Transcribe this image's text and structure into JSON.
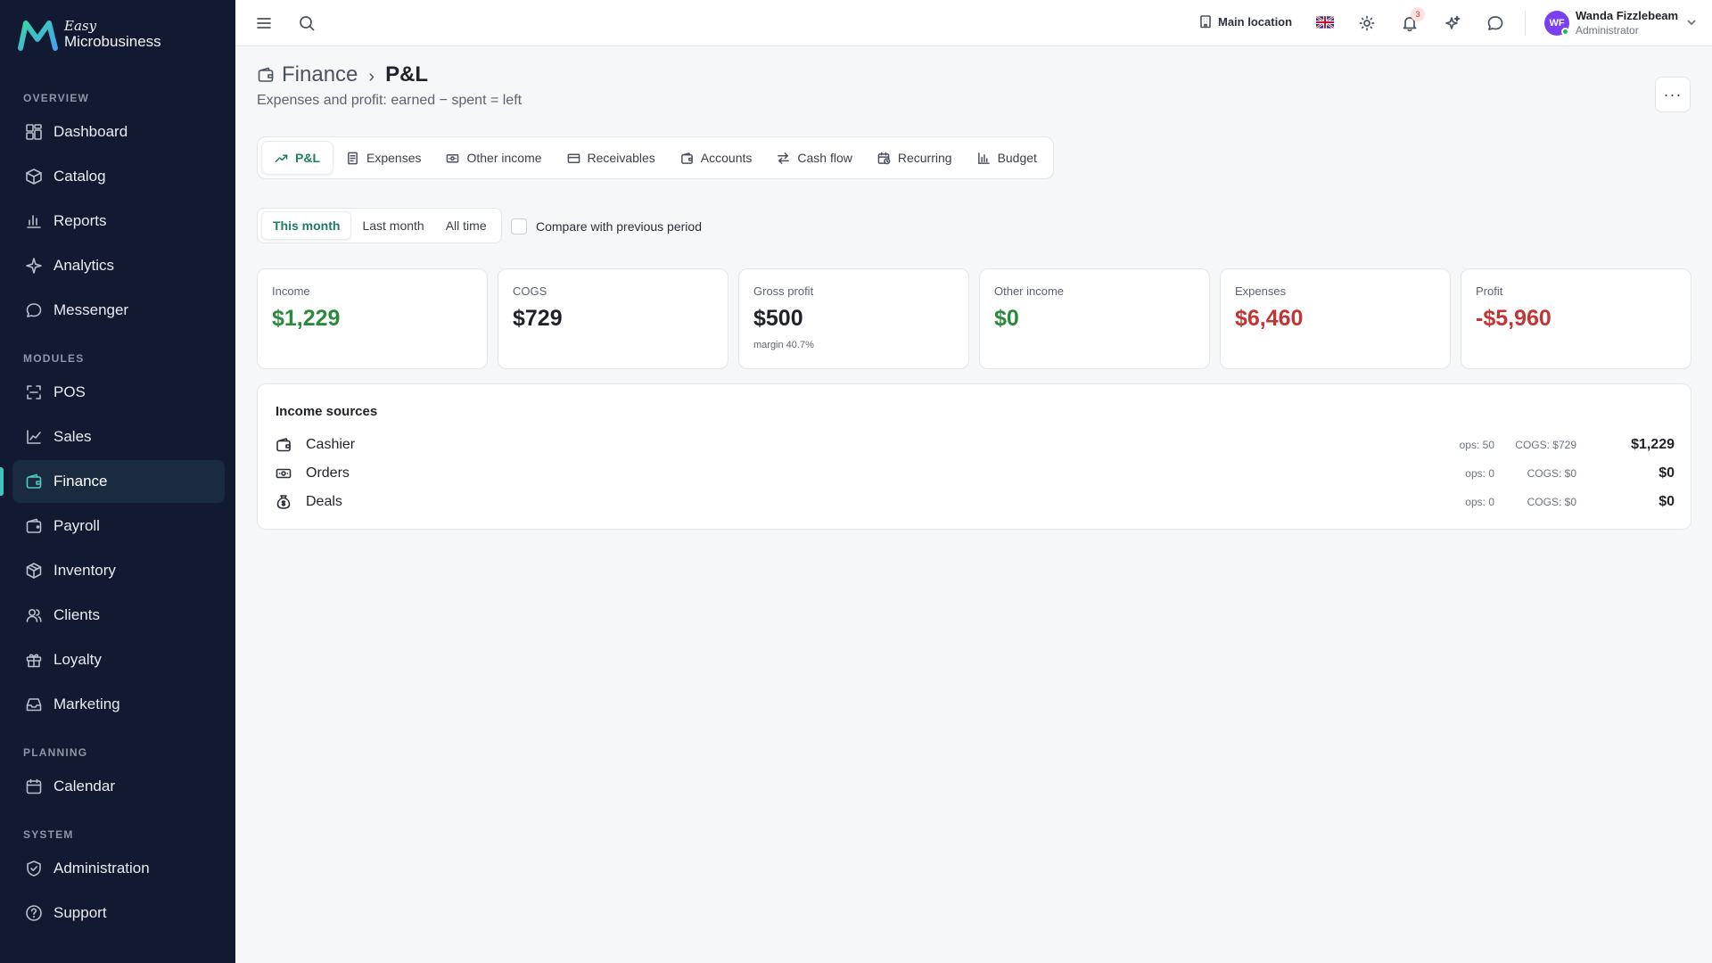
{
  "brand": {
    "small": "Easy",
    "big": "Microbusiness"
  },
  "sidebar": {
    "sections": {
      "overview": "OVERVIEW",
      "modules": "MODULES",
      "planning": "PLANNING",
      "system": "SYSTEM"
    },
    "items": [
      {
        "label": "Dashboard",
        "icon": "dashboard-icon"
      },
      {
        "label": "Catalog",
        "icon": "catalog-icon"
      },
      {
        "label": "Reports",
        "icon": "reports-icon"
      },
      {
        "label": "Analytics",
        "icon": "analytics-icon"
      },
      {
        "label": "Messenger",
        "icon": "messenger-icon"
      },
      {
        "label": "POS",
        "icon": "pos-icon"
      },
      {
        "label": "Sales",
        "icon": "sales-icon"
      },
      {
        "label": "Finance",
        "icon": "finance-icon",
        "active": true
      },
      {
        "label": "Payroll",
        "icon": "payroll-icon"
      },
      {
        "label": "Inventory",
        "icon": "inventory-icon"
      },
      {
        "label": "Clients",
        "icon": "clients-icon"
      },
      {
        "label": "Loyalty",
        "icon": "loyalty-icon"
      },
      {
        "label": "Marketing",
        "icon": "marketing-icon"
      },
      {
        "label": "Calendar",
        "icon": "calendar-icon"
      },
      {
        "label": "Administration",
        "icon": "administration-icon"
      },
      {
        "label": "Support",
        "icon": "support-icon"
      }
    ],
    "accent": "#3fc7bd",
    "background": "#111a30"
  },
  "topbar": {
    "location": "Main location",
    "notifications_count": "3",
    "user": {
      "initials": "WF",
      "name": "Wanda Fizzlebeam",
      "role": "Administrator"
    }
  },
  "page": {
    "breadcrumb_parent": "Finance",
    "breadcrumb_sep": "›",
    "title": "P&L",
    "subtitle": "Expenses and profit: earned − spent = left",
    "more": "···"
  },
  "tabs": [
    {
      "label": "P&L",
      "icon": "trending-up-icon",
      "active": true
    },
    {
      "label": "Expenses",
      "icon": "receipt-icon"
    },
    {
      "label": "Other income",
      "icon": "banknote-icon"
    },
    {
      "label": "Receivables",
      "icon": "credit-card-icon"
    },
    {
      "label": "Accounts",
      "icon": "wallet-icon"
    },
    {
      "label": "Cash flow",
      "icon": "arrows-exchange-icon"
    },
    {
      "label": "Recurring",
      "icon": "calendar-clock-icon"
    },
    {
      "label": "Budget",
      "icon": "bar-chart-icon"
    }
  ],
  "period": {
    "options": [
      "This month",
      "Last month",
      "All time"
    ],
    "selected": "This month",
    "compare_label": "Compare with previous period"
  },
  "cards": [
    {
      "label": "Income",
      "value": "$1,229",
      "tone": "green"
    },
    {
      "label": "COGS",
      "value": "$729",
      "tone": "dark"
    },
    {
      "label": "Gross profit",
      "value": "$500",
      "tone": "dark",
      "sub": "margin 40.7%"
    },
    {
      "label": "Other income",
      "value": "$0",
      "tone": "green"
    },
    {
      "label": "Expenses",
      "value": "$6,460",
      "tone": "red"
    },
    {
      "label": "Profit",
      "value": "-$5,960",
      "tone": "red"
    }
  ],
  "income_sources": {
    "title": "Income sources",
    "rows": [
      {
        "name": "Cashier",
        "icon": "wallet-icon",
        "ops": "ops: 50",
        "cogs": "COGS: $729",
        "total": "$1,229"
      },
      {
        "name": "Orders",
        "icon": "banknote-icon",
        "ops": "ops: 0",
        "cogs": "COGS: $0",
        "total": "$0"
      },
      {
        "name": "Deals",
        "icon": "handshake-icon",
        "ops": "ops: 0",
        "cogs": "COGS: $0",
        "total": "$0"
      }
    ]
  },
  "colors": {
    "positive": "#2c8a3c",
    "negative": "#c23535",
    "tab_accent": "#1d7d64"
  }
}
